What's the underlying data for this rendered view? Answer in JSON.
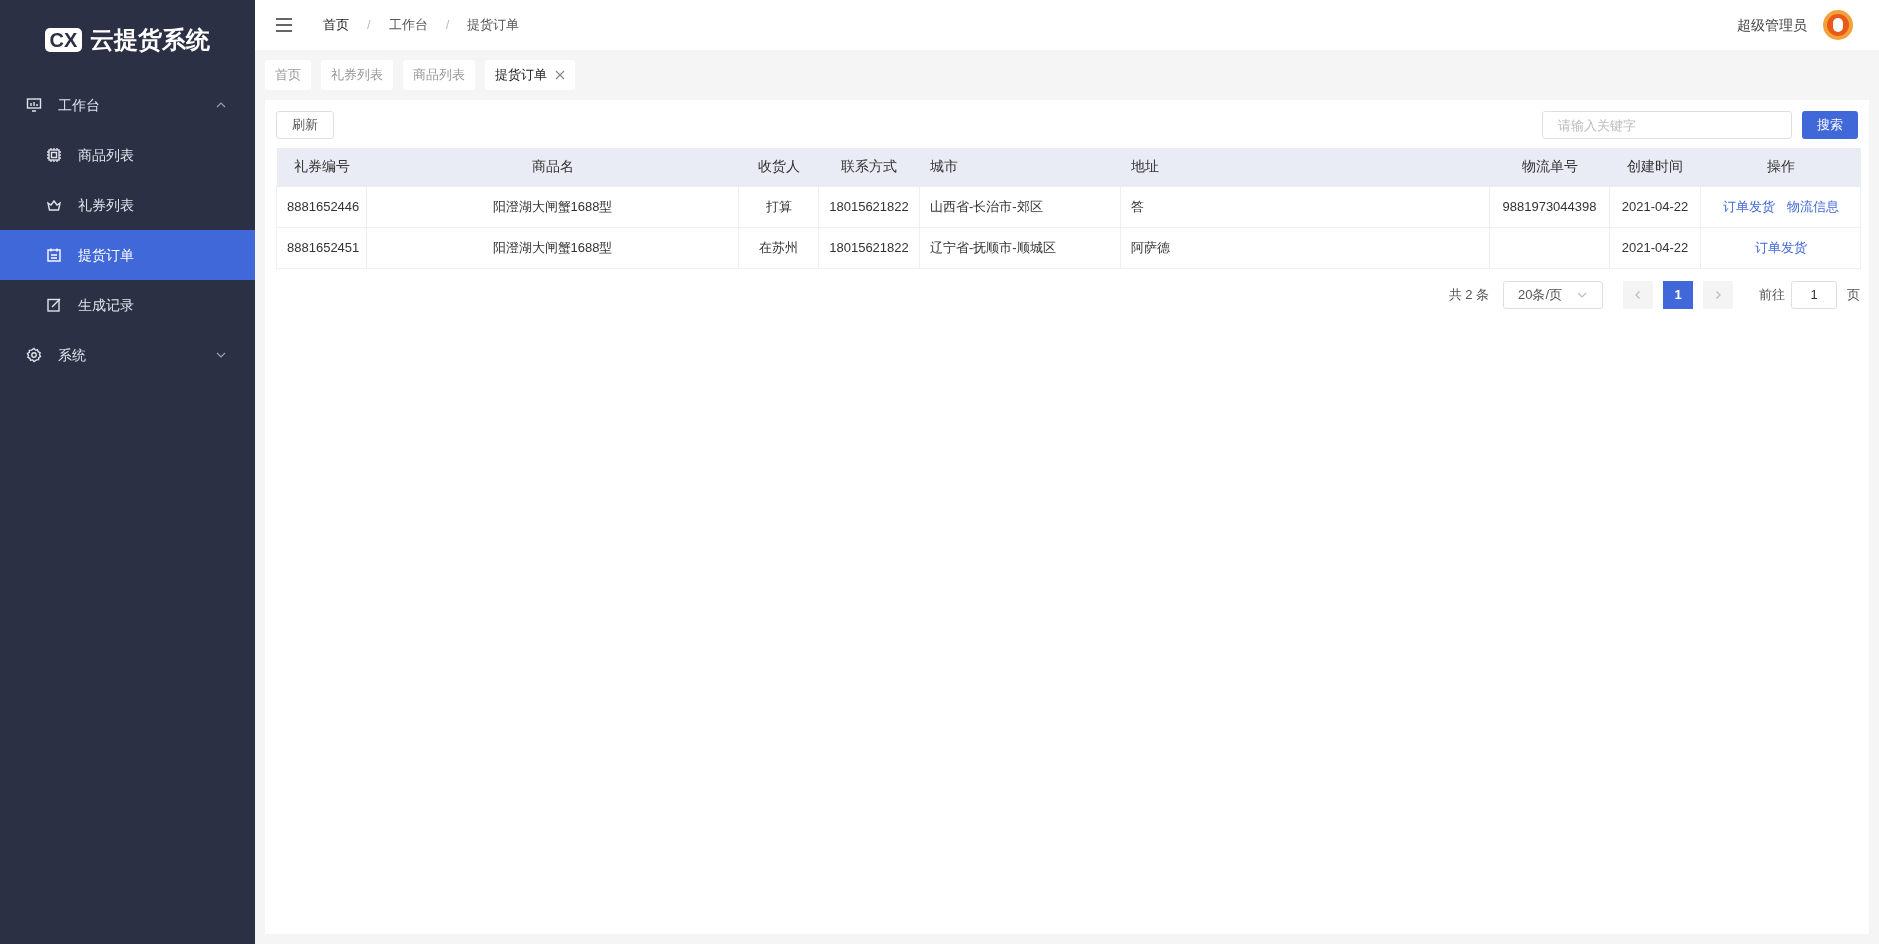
{
  "logo": {
    "mark": "CX",
    "title": "云提货系统"
  },
  "sidebar": {
    "items": [
      {
        "label": "工作台",
        "expanded": true,
        "children": [
          {
            "label": "商品列表",
            "selected": false
          },
          {
            "label": "礼券列表",
            "selected": false
          },
          {
            "label": "提货订单",
            "selected": true
          },
          {
            "label": "生成记录",
            "selected": false
          }
        ]
      },
      {
        "label": "系统",
        "expanded": false
      }
    ]
  },
  "breadcrumb": [
    "首页",
    "工作台",
    "提货订单"
  ],
  "breadcrumb_separator": "/",
  "user": {
    "name": "超级管理员"
  },
  "tabs": [
    {
      "label": "首页",
      "selected": false
    },
    {
      "label": "礼券列表",
      "selected": false
    },
    {
      "label": "商品列表",
      "selected": false
    },
    {
      "label": "提货订单",
      "selected": true
    }
  ],
  "toolbar": {
    "refresh": "刷新",
    "search_placeholder": "请输入关键字",
    "search": "搜索"
  },
  "table": {
    "columns": [
      "礼券编号",
      "商品名",
      "收货人",
      "联系方式",
      "城市",
      "地址",
      "物流单号",
      "创建时间",
      "操作"
    ],
    "rows": [
      {
        "cells": [
          "8881652446",
          "阳澄湖大闸蟹1688型",
          "打算",
          "18015621822",
          "山西省-长治市-郊区",
          "答",
          "9881973044398",
          "2021-04-22"
        ],
        "actions": [
          "订单发货",
          "物流信息"
        ]
      },
      {
        "cells": [
          "8881652451",
          "阳澄湖大闸蟹1688型",
          "在苏州",
          "18015621822",
          "辽宁省-抚顺市-顺城区",
          "阿萨德",
          "",
          "2021-04-22"
        ],
        "actions": [
          "订单发货"
        ]
      }
    ]
  },
  "pagination": {
    "total": "共 2 条",
    "page_size": "20条/页",
    "pages": [
      {
        "label": "1",
        "selected": true
      }
    ],
    "goto_label": "前往",
    "goto_value": "1",
    "goto_suffix": "页"
  }
}
